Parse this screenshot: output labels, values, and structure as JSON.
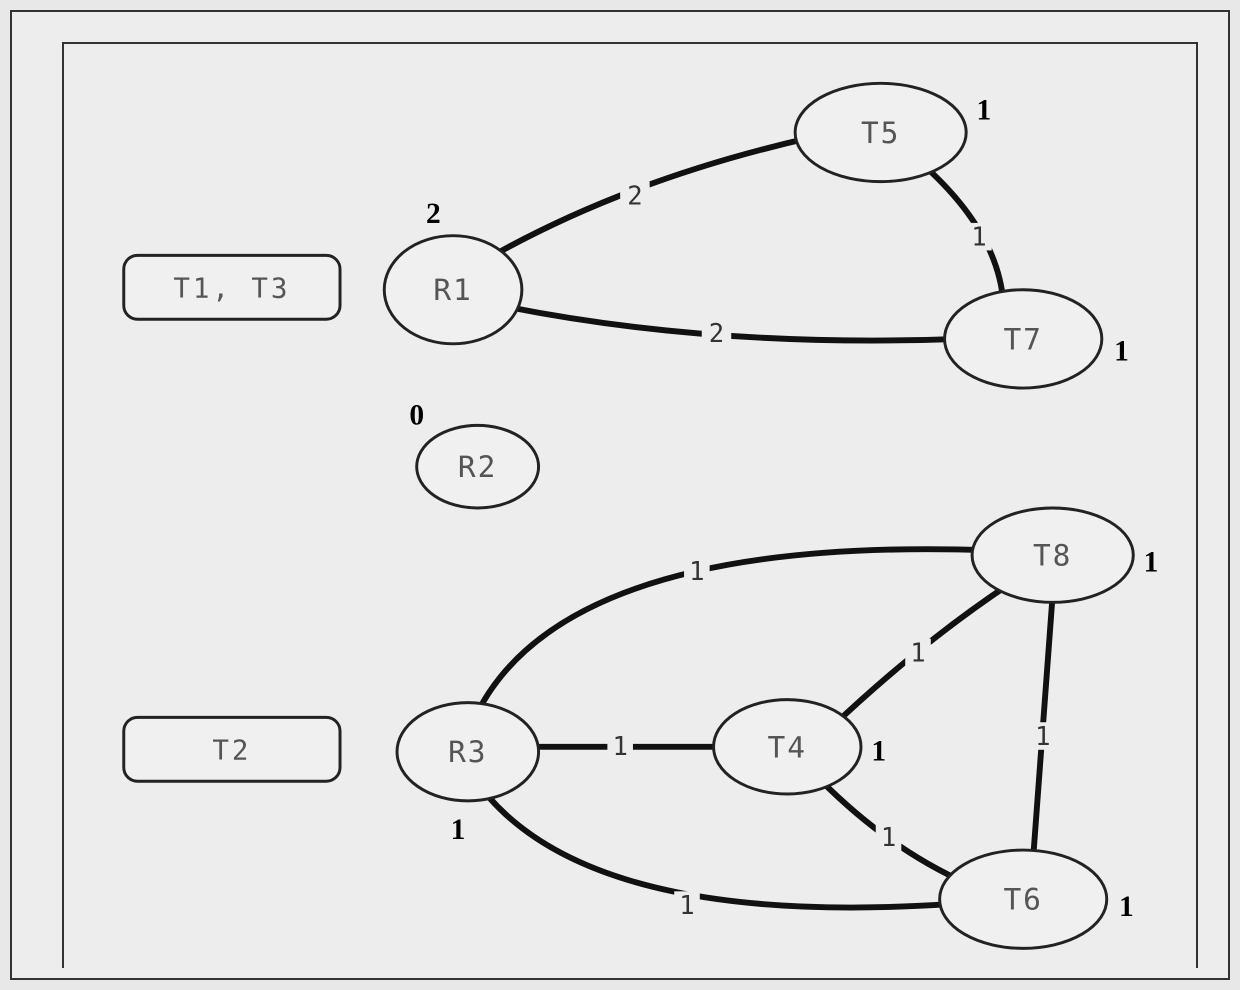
{
  "boxes": {
    "top": "T1, T3",
    "bottom": "T2"
  },
  "nodes": {
    "R1": {
      "label": "R1",
      "weight": "2"
    },
    "R2": {
      "label": "R2",
      "weight": "0"
    },
    "R3": {
      "label": "R3",
      "weight": "1"
    },
    "T4": {
      "label": "T4",
      "weight": "1"
    },
    "T5": {
      "label": "T5",
      "weight": "1"
    },
    "T6": {
      "label": "T6",
      "weight": "1"
    },
    "T7": {
      "label": "T7",
      "weight": "1"
    },
    "T8": {
      "label": "T8",
      "weight": "1"
    }
  },
  "edges": {
    "R1_T5": "2",
    "R1_T7": "2",
    "T5_T7": "1",
    "R3_T8": "1",
    "R3_T4": "1",
    "R3_T6": "1",
    "T4_T8": "1",
    "T4_T6": "1",
    "T8_T6": "1"
  }
}
